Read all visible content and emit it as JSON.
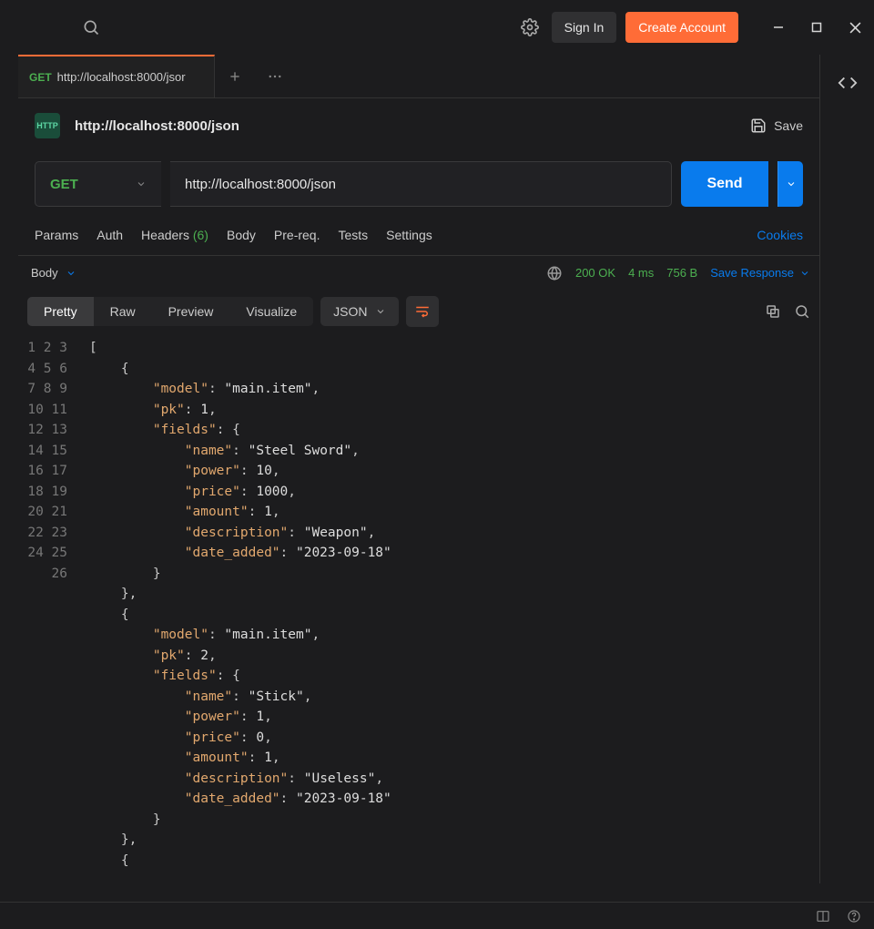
{
  "titlebar": {
    "signin": "Sign In",
    "create": "Create Account"
  },
  "tab": {
    "method": "GET",
    "title": "http://localhost:8000/jsor"
  },
  "request": {
    "title": "http://localhost:8000/json",
    "save_label": "Save",
    "method": "GET",
    "url": "http://localhost:8000/json",
    "send": "Send"
  },
  "subtabs": {
    "params": "Params",
    "auth": "Auth",
    "headers": "Headers",
    "headers_count": "(6)",
    "body": "Body",
    "prereq": "Pre-req.",
    "tests": "Tests",
    "settings": "Settings",
    "cookies": "Cookies"
  },
  "response": {
    "body_label": "Body",
    "status": "200 OK",
    "time": "4 ms",
    "size": "756 B",
    "save_response": "Save Response"
  },
  "viewbar": {
    "pretty": "Pretty",
    "raw": "Raw",
    "preview": "Preview",
    "visualize": "Visualize",
    "json": "JSON"
  },
  "code_lines": [
    "[",
    "    {",
    "        \"model\": \"main.item\",",
    "        \"pk\": 1,",
    "        \"fields\": {",
    "            \"name\": \"Steel Sword\",",
    "            \"power\": 10,",
    "            \"price\": 1000,",
    "            \"amount\": 1,",
    "            \"description\": \"Weapon\",",
    "            \"date_added\": \"2023-09-18\"",
    "        }",
    "    },",
    "    {",
    "        \"model\": \"main.item\",",
    "        \"pk\": 2,",
    "        \"fields\": {",
    "            \"name\": \"Stick\",",
    "            \"power\": 1,",
    "            \"price\": 0,",
    "            \"amount\": 1,",
    "            \"description\": \"Useless\",",
    "            \"date_added\": \"2023-09-18\"",
    "        }",
    "    },",
    "    {"
  ]
}
